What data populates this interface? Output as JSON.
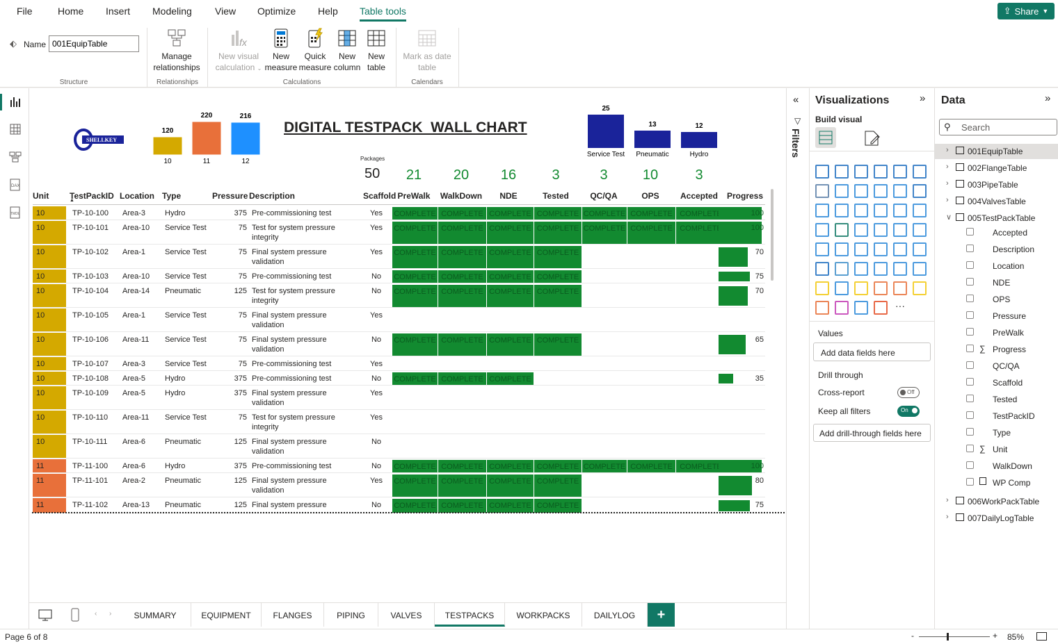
{
  "menu": [
    "File",
    "Home",
    "Insert",
    "Modeling",
    "View",
    "Optimize",
    "Help",
    "Table tools"
  ],
  "share_label": "Share",
  "ribbon": {
    "name_label": "Name",
    "name_value": "001EquipTable",
    "manage_rel": [
      "Manage",
      "relationships"
    ],
    "new_visual_calc": [
      "New visual",
      "calculation"
    ],
    "new_measure": [
      "New",
      "measure"
    ],
    "quick_measure": [
      "Quick",
      "measure"
    ],
    "new_column": [
      "New",
      "column"
    ],
    "new_table": [
      "New",
      "table"
    ],
    "mark_date": [
      "Mark as date",
      "table"
    ],
    "groups": {
      "structure": "Structure",
      "relationships": "Relationships",
      "calculations": "Calculations",
      "calendars": "Calendars"
    }
  },
  "report": {
    "title": "DIGITAL TESTPACK  WALL CHART",
    "logo_text": "SHELLKEY",
    "units_chart": {
      "bars": [
        {
          "label": "10",
          "value": 120,
          "color": "#d4a900"
        },
        {
          "label": "11",
          "value": 220,
          "color": "#e8703a"
        },
        {
          "label": "12",
          "value": 216,
          "color": "#1e90ff"
        }
      ]
    },
    "type_chart": {
      "bars": [
        {
          "label": "Service Test",
          "value": 25
        },
        {
          "label": "Pneumatic",
          "value": 13
        },
        {
          "label": "Hydro",
          "value": 12
        }
      ],
      "color": "#1a239a"
    },
    "packages_label": "Packages",
    "packages_value": "50",
    "kpis": [
      {
        "value": "21",
        "col": "prewalk"
      },
      {
        "value": "20",
        "col": "walkdown"
      },
      {
        "value": "16",
        "col": "nde"
      },
      {
        "value": "3",
        "col": "tested"
      },
      {
        "value": "3",
        "col": "qcqa"
      },
      {
        "value": "10",
        "col": "ops"
      },
      {
        "value": "3",
        "col": "accepted"
      }
    ],
    "headers": [
      "Unit",
      "TestPackID",
      "Location",
      "Type",
      "Pressure",
      "Description",
      "Scaffold",
      "PreWalk",
      "WalkDown",
      "NDE",
      "Tested",
      "QC/QA",
      "OPS",
      "Accepted",
      "Progress"
    ],
    "complete_label": "COMPLETE",
    "rows": [
      {
        "unit": "10",
        "id": "TP-10-100",
        "loc": "Area-3",
        "type": "Hydro",
        "pressure": "375",
        "desc": [
          "Pre-commissioning test"
        ],
        "scaffold": "Yes",
        "stages": 7,
        "progress": 100
      },
      {
        "unit": "10",
        "id": "TP-10-101",
        "loc": "Area-10",
        "type": "Service Test",
        "pressure": "75",
        "desc": [
          "Test for system pressure",
          "integrity"
        ],
        "scaffold": "Yes",
        "stages": 7,
        "progress": 100
      },
      {
        "unit": "10",
        "id": "TP-10-102",
        "loc": "Area-1",
        "type": "Service Test",
        "pressure": "75",
        "desc": [
          "Final system pressure",
          "validation"
        ],
        "scaffold": "Yes",
        "stages": 4,
        "progress": 70
      },
      {
        "unit": "10",
        "id": "TP-10-103",
        "loc": "Area-10",
        "type": "Service Test",
        "pressure": "75",
        "desc": [
          "Pre-commissioning test"
        ],
        "scaffold": "No",
        "stages": 4,
        "progress": 75
      },
      {
        "unit": "10",
        "id": "TP-10-104",
        "loc": "Area-14",
        "type": "Pneumatic",
        "pressure": "125",
        "desc": [
          "Test for system pressure",
          "integrity"
        ],
        "scaffold": "No",
        "stages": 4,
        "progress": 70
      },
      {
        "unit": "10",
        "id": "TP-10-105",
        "loc": "Area-1",
        "type": "Service Test",
        "pressure": "75",
        "desc": [
          "Final system pressure",
          "validation"
        ],
        "scaffold": "Yes",
        "stages": 0,
        "progress": null
      },
      {
        "unit": "10",
        "id": "TP-10-106",
        "loc": "Area-11",
        "type": "Service Test",
        "pressure": "75",
        "desc": [
          "Final system pressure",
          "validation"
        ],
        "scaffold": "No",
        "stages": 4,
        "progress": 65
      },
      {
        "unit": "10",
        "id": "TP-10-107",
        "loc": "Area-3",
        "type": "Service Test",
        "pressure": "75",
        "desc": [
          "Pre-commissioning test"
        ],
        "scaffold": "Yes",
        "stages": 0,
        "progress": null
      },
      {
        "unit": "10",
        "id": "TP-10-108",
        "loc": "Area-5",
        "type": "Hydro",
        "pressure": "375",
        "desc": [
          "Pre-commissioning test"
        ],
        "scaffold": "No",
        "stages": 3,
        "progress": 35
      },
      {
        "unit": "10",
        "id": "TP-10-109",
        "loc": "Area-5",
        "type": "Hydro",
        "pressure": "375",
        "desc": [
          "Final system pressure",
          "validation"
        ],
        "scaffold": "Yes",
        "stages": 0,
        "progress": null
      },
      {
        "unit": "10",
        "id": "TP-10-110",
        "loc": "Area-11",
        "type": "Service Test",
        "pressure": "75",
        "desc": [
          "Test for system pressure",
          "integrity"
        ],
        "scaffold": "Yes",
        "stages": 0,
        "progress": null
      },
      {
        "unit": "10",
        "id": "TP-10-111",
        "loc": "Area-6",
        "type": "Pneumatic",
        "pressure": "125",
        "desc": [
          "Final system pressure",
          "validation"
        ],
        "scaffold": "No",
        "stages": 0,
        "progress": null
      },
      {
        "unit": "11",
        "id": "TP-11-100",
        "loc": "Area-6",
        "type": "Hydro",
        "pressure": "375",
        "desc": [
          "Pre-commissioning test"
        ],
        "scaffold": "No",
        "stages": 7,
        "progress": 100
      },
      {
        "unit": "11",
        "id": "TP-11-101",
        "loc": "Area-2",
        "type": "Pneumatic",
        "pressure": "125",
        "desc": [
          "Final system pressure",
          "validation"
        ],
        "scaffold": "Yes",
        "stages": 4,
        "progress": 80
      },
      {
        "unit": "11",
        "id": "TP-11-102",
        "loc": "Area-13",
        "type": "Pneumatic",
        "pressure": "125",
        "desc": [
          "Final system pressure"
        ],
        "scaffold": "No",
        "stages": 4,
        "progress": 75
      }
    ],
    "unit_colors": {
      "10": "#d4a900",
      "11": "#e8703a"
    }
  },
  "filters_label": "Filters",
  "viz": {
    "title": "Visualizations",
    "build_visual": "Build visual",
    "values_label": "Values",
    "values_placeholder": "Add data fields here",
    "drill_label": "Drill through",
    "cross_report": "Cross-report",
    "cross_state": "Off",
    "keep_filters": "Keep all filters",
    "keep_state": "On",
    "drill_placeholder": "Add drill-through fields here"
  },
  "data": {
    "title": "Data",
    "search_placeholder": "Search",
    "tables_top": [
      "001EquipTable",
      "002FlangeTable",
      "003PipeTable",
      "004ValvesTable",
      "005TestPackTable"
    ],
    "fields": [
      {
        "name": "Accepted",
        "sigma": false
      },
      {
        "name": "Description",
        "sigma": false
      },
      {
        "name": "Location",
        "sigma": false
      },
      {
        "name": "NDE",
        "sigma": false
      },
      {
        "name": "OPS",
        "sigma": false
      },
      {
        "name": "Pressure",
        "sigma": false
      },
      {
        "name": "PreWalk",
        "sigma": false
      },
      {
        "name": "Progress",
        "sigma": true
      },
      {
        "name": "QC/QA",
        "sigma": false
      },
      {
        "name": "Scaffold",
        "sigma": false
      },
      {
        "name": "Tested",
        "sigma": false
      },
      {
        "name": "TestPackID",
        "sigma": false
      },
      {
        "name": "Type",
        "sigma": false
      },
      {
        "name": "Unit",
        "sigma": true
      },
      {
        "name": "WalkDown",
        "sigma": false
      },
      {
        "name": "WP Comp",
        "sigma": false
      }
    ],
    "tables_bottom": [
      "006WorkPackTable",
      "007DailyLogTable"
    ]
  },
  "tabs": [
    "SUMMARY",
    "EQUIPMENT",
    "FLANGES",
    "PIPING",
    "VALVES",
    "TESTPACKS",
    "WORKPACKS",
    "DAILYLOG"
  ],
  "active_tab": "TESTPACKS",
  "status": {
    "page": "Page 6 of 8",
    "zoom": "85%"
  }
}
